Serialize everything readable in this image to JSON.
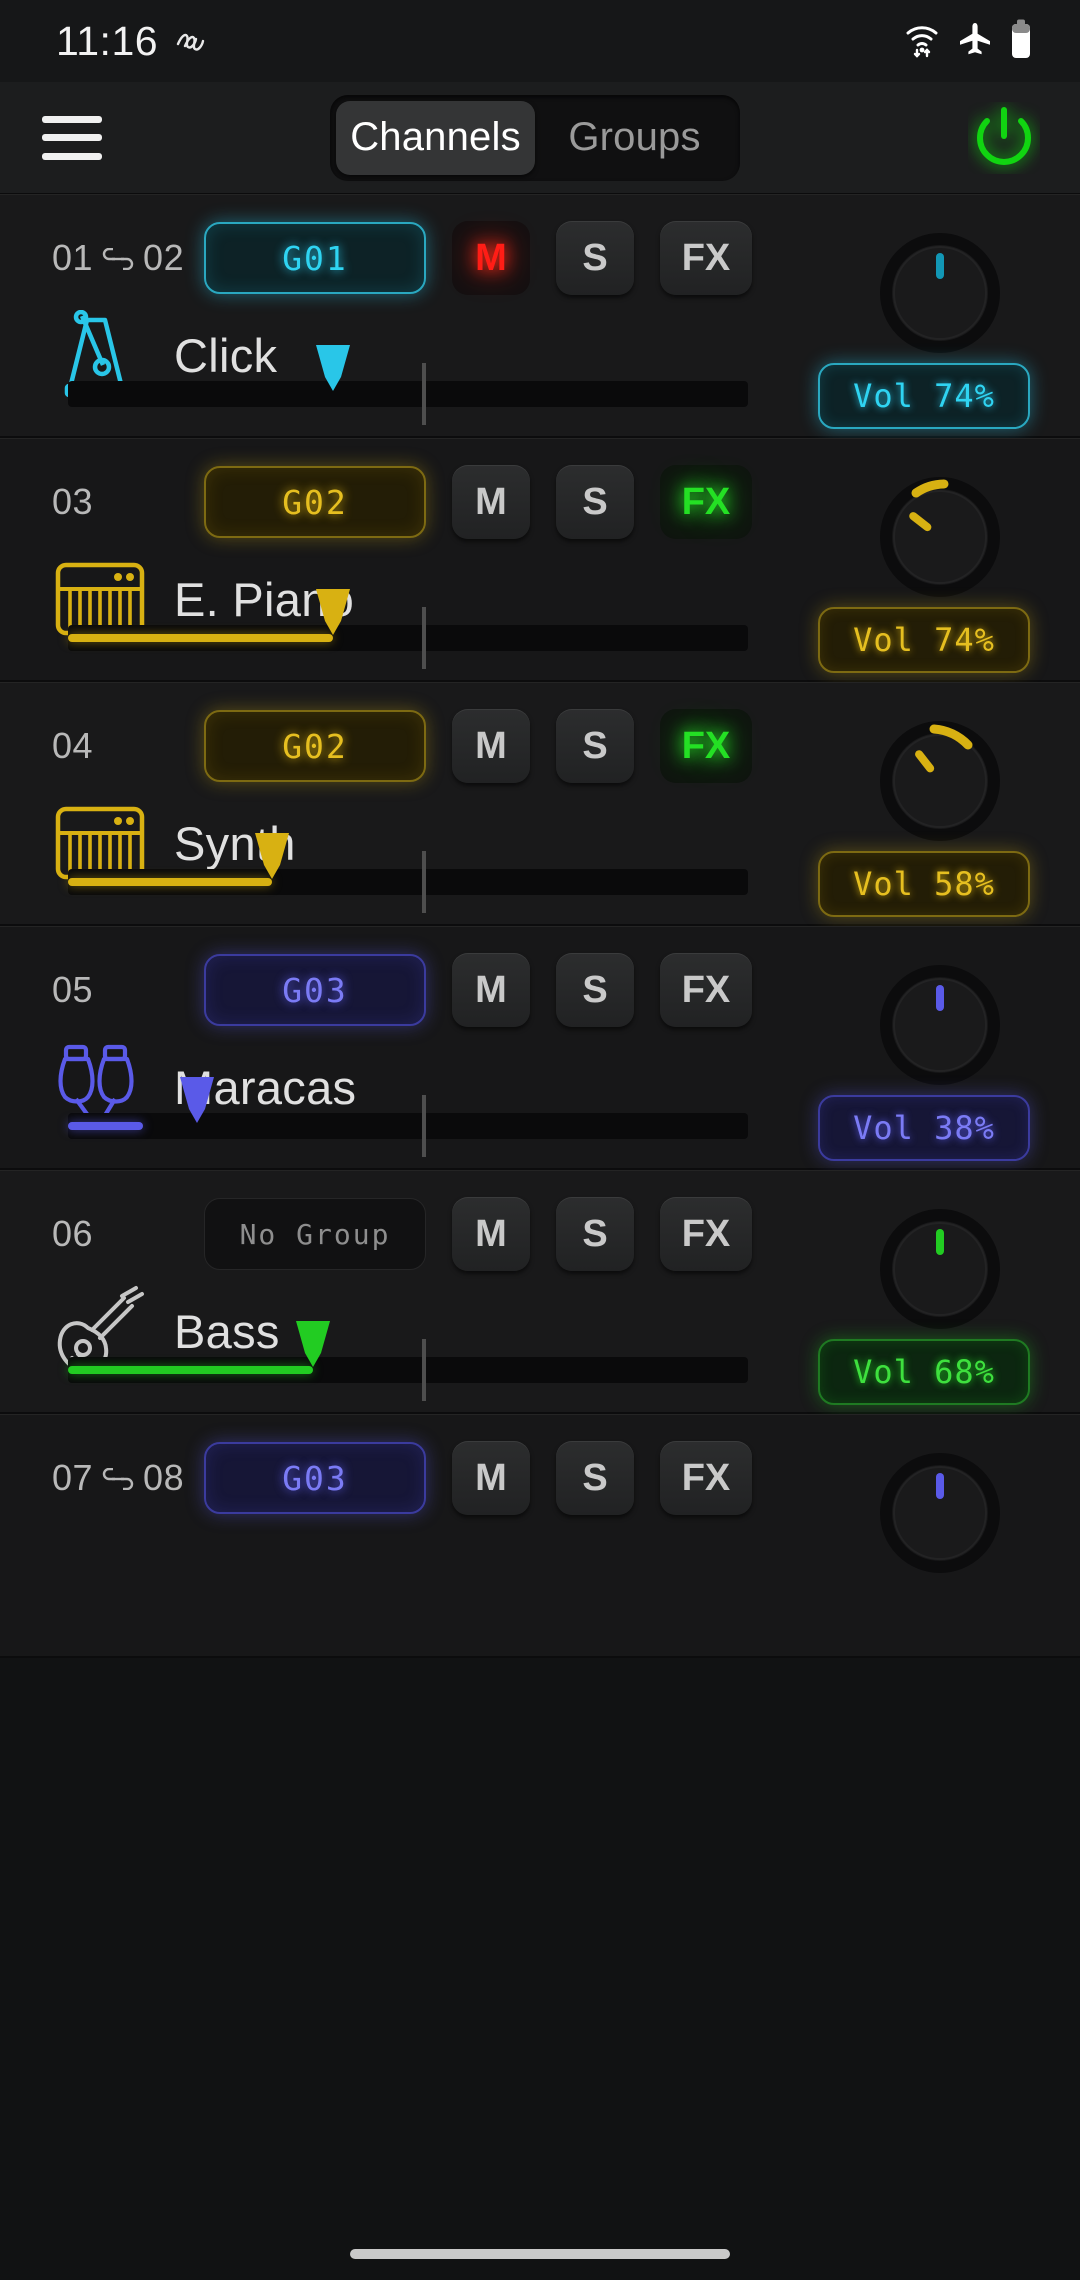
{
  "status_bar": {
    "time": "11:16",
    "icons": [
      "sleep-mode-icon",
      "wifi-icon",
      "airplane-mode-icon",
      "battery-icon"
    ]
  },
  "header": {
    "menu_icon": "hamburger-menu-icon",
    "tabs": [
      {
        "label": "Channels",
        "active": true
      },
      {
        "label": "Groups",
        "active": false
      }
    ],
    "power_icon": "power-icon"
  },
  "colors": {
    "cyan": "#29c6e8",
    "yellow": "#d8b112",
    "indigo": "#5a5ae8",
    "green": "#22cc22",
    "mute_red": "#ff1d16",
    "fx_green": "#24e024",
    "no_group_gray": "#8e8e8e"
  },
  "channels": [
    {
      "number": "01",
      "number2": "02",
      "linked": true,
      "group": "G01",
      "group_color": "#29c6e8",
      "mute": true,
      "solo": false,
      "fx": false,
      "icon": "metronome-icon",
      "name": "Click",
      "volume_label": "Vol 74%",
      "volume_pct": 74,
      "fader_pos_pct": 39,
      "fill": false,
      "pan_angle": 0,
      "pan_arc": false,
      "color": "#29c6e8"
    },
    {
      "number": "03",
      "number2": "",
      "linked": false,
      "group": "G02",
      "group_color": "#d8b112",
      "mute": false,
      "solo": false,
      "fx": true,
      "icon": "keyboard-icon",
      "name": "E. Piano",
      "volume_label": "Vol 74%",
      "volume_pct": 74,
      "fader_pos_pct": 39,
      "fill": true,
      "pan_angle": -52,
      "pan_arc": true,
      "color": "#d8b112"
    },
    {
      "number": "04",
      "number2": "",
      "linked": false,
      "group": "G02",
      "group_color": "#d8b112",
      "mute": false,
      "solo": false,
      "fx": true,
      "icon": "keyboard-icon",
      "name": "Synth",
      "volume_label": "Vol 58%",
      "volume_pct": 58,
      "fader_pos_pct": 30,
      "fill": true,
      "pan_angle": -38,
      "pan_arc": true,
      "color": "#d8b112"
    },
    {
      "number": "05",
      "number2": "",
      "linked": false,
      "group": "G03",
      "group_color": "#5a5ae8",
      "mute": false,
      "solo": false,
      "fx": false,
      "icon": "maracas-icon",
      "name": "Maracas",
      "volume_label": "Vol 38%",
      "volume_pct": 38,
      "fader_pos_pct": 19,
      "fill": true,
      "pan_angle": 0,
      "pan_arc": false,
      "color": "#5a5ae8"
    },
    {
      "number": "06",
      "number2": "",
      "linked": false,
      "group": "No Group",
      "group_color": "#8e8e8e",
      "mute": false,
      "solo": false,
      "fx": false,
      "icon": "guitar-icon",
      "name": "Bass",
      "volume_label": "Vol 68%",
      "volume_pct": 68,
      "fader_pos_pct": 36,
      "fill": true,
      "pan_angle": 0,
      "pan_arc": false,
      "color": "#22cc22"
    },
    {
      "number": "07",
      "number2": "08",
      "linked": true,
      "group": "G03",
      "group_color": "#5a5ae8",
      "mute": false,
      "solo": false,
      "fx": false,
      "icon": "",
      "name": "",
      "volume_label": "",
      "volume_pct": 0,
      "fader_pos_pct": 0,
      "fill": false,
      "pan_angle": 0,
      "pan_arc": false,
      "color": "#5a5ae8"
    }
  ],
  "channel_buttons": {
    "mute": "M",
    "solo": "S",
    "fx": "FX"
  }
}
